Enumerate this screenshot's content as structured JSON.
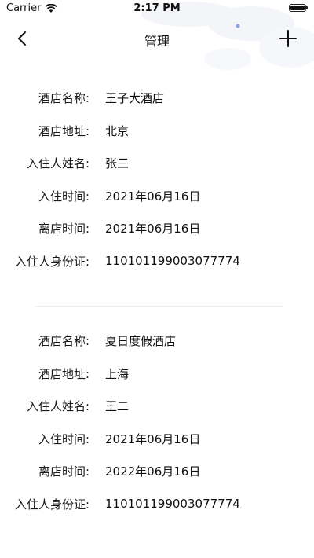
{
  "status_bar": {
    "carrier": "Carrier",
    "wifi_icon": "wifi-icon",
    "time": "2:17 PM",
    "battery_icon": "battery-icon"
  },
  "nav": {
    "back_icon": "chevron-left-icon",
    "title": "管理",
    "add_icon": "plus-icon"
  },
  "records": [
    {
      "fields": [
        {
          "label": "酒店名称:",
          "value": "王子大酒店"
        },
        {
          "label": "酒店地址:",
          "value": "北京"
        },
        {
          "label": "入住人姓名:",
          "value": "张三"
        },
        {
          "label": "入住时间:",
          "value": "2021年06月16日"
        },
        {
          "label": "离店时间:",
          "value": "2021年06月16日"
        },
        {
          "label": "入住人身份证:",
          "value": "110101199003077774"
        }
      ]
    },
    {
      "fields": [
        {
          "label": "酒店名称:",
          "value": "夏日度假酒店"
        },
        {
          "label": "酒店地址:",
          "value": "上海"
        },
        {
          "label": "入住人姓名:",
          "value": "王二"
        },
        {
          "label": "入住时间:",
          "value": "2021年06月16日"
        },
        {
          "label": "离店时间:",
          "value": "2022年06月16日"
        },
        {
          "label": "入住人身份证:",
          "value": "110101199003077774"
        }
      ]
    }
  ]
}
